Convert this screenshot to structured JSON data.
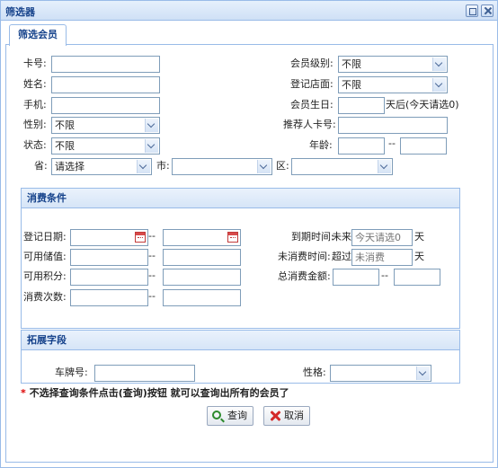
{
  "window": {
    "title": "筛选器"
  },
  "tabs": [
    {
      "label": "筛选会员"
    }
  ],
  "basic": {
    "card_no_label": "卡号:",
    "name_label": "姓名:",
    "phone_label": "手机:",
    "gender_label": "性别:",
    "gender_value": "不限",
    "status_label": "状态:",
    "status_value": "不限",
    "level_label": "会员级别:",
    "level_value": "不限",
    "store_label": "登记店面:",
    "store_value": "不限",
    "birthday_label": "会员生日:",
    "birthday_suffix": "天后(今天请选0)",
    "referrer_label": "推荐人卡号:",
    "age_label": "年龄:",
    "age_sep": "--",
    "province_label": "省:",
    "province_value": "请选择",
    "city_label": "市:",
    "district_label": "区:"
  },
  "consumption": {
    "title": "消费条件",
    "reg_date_label": "登记日期:",
    "balance_label": "可用储值:",
    "points_label": "可用积分:",
    "count_label": "消费次数:",
    "range_sep": "--",
    "expire_label": "到期时间:",
    "expire_prefix": "未来",
    "expire_placeholder": "今天请选0",
    "expire_suffix": "天",
    "nospend_label": "未消费时间:",
    "nospend_prefix": "超过",
    "nospend_placeholder": "未消费",
    "nospend_suffix": "天",
    "total_label": "总消费金额:"
  },
  "extended": {
    "title": "拓展字段",
    "plate_label": "车牌号:",
    "personality_label": "性格:"
  },
  "note": {
    "star": "*",
    "text": "不选择查询条件点击(查询)按钮 就可以查询出所有的会员了"
  },
  "actions": {
    "query_label": "查询",
    "cancel_label": "取消"
  },
  "colors": {
    "border": "#99bbe8",
    "header_text": "#15428b",
    "required_star": "#dd0000"
  }
}
